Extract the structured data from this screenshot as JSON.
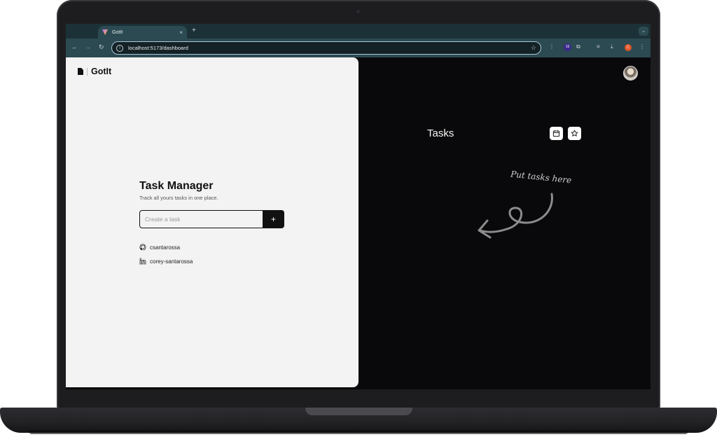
{
  "browser": {
    "tab_title": "GotIt",
    "tab_close": "×",
    "new_tab": "+",
    "tab_menu": "⌄",
    "url": "localhost:5173/dashboard",
    "back": "←",
    "forward": "→",
    "reload": "↻",
    "extension_badge": "16",
    "profile_initial": "C"
  },
  "sidebar": {
    "brand": "GotIt"
  },
  "hero": {
    "title": "Task Manager",
    "subtitle": "Track all yours tasks in one place.",
    "input_placeholder": "Create a task",
    "add_label": "+"
  },
  "links": [
    {
      "icon": "github-icon",
      "label": "csantarossa"
    },
    {
      "icon": "linkedin-icon",
      "label": "corey-santarossa"
    }
  ],
  "tasks": {
    "title": "Tasks",
    "hint": "Put tasks here"
  },
  "colors": {
    "left_panel": "#f3f3f3",
    "right_panel": "#09090b",
    "accent": "#111111",
    "browser_chrome": "#2c4a52"
  }
}
